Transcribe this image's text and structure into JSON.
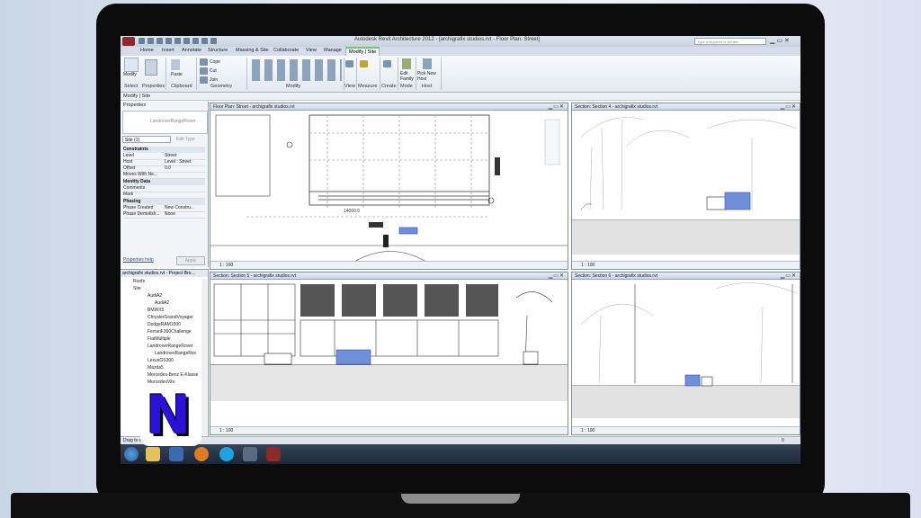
{
  "window": {
    "title": "Autodesk Revit Architecture 2012 - [archigrafix studios.rvt - Floor Plan: Street]",
    "search_placeholder": "Type a keyword or phrase"
  },
  "ribbon_tabs": [
    "Home",
    "Insert",
    "Annotate",
    "Structure",
    "Massing & Site",
    "Collaborate",
    "View",
    "Manage",
    "Modify | Site"
  ],
  "ribbon": {
    "buttons": {
      "modify": "Modify",
      "paste": "Paste",
      "cope": "Cope",
      "cut": "Cut",
      "join": "Join",
      "edit_family": "Edit Family",
      "pick_new_host": "Pick New Host"
    },
    "panels": [
      "Select",
      "Properties",
      "Clipboard",
      "Geometry",
      "Modify",
      "View",
      "Measure",
      "Create",
      "Mode",
      "Host"
    ]
  },
  "context_bar": "Modify | Site",
  "properties": {
    "title": "Properties",
    "type_name": "LandroverRangeRover",
    "selector": "Site (1)",
    "edit_type": "Edit Type",
    "groups": [
      {
        "name": "Constraints",
        "rows": [
          {
            "k": "Level",
            "v": "Street"
          },
          {
            "k": "Host",
            "v": "Level : Street"
          },
          {
            "k": "Offset",
            "v": "0.0"
          },
          {
            "k": "Moves With Ne...",
            "v": ""
          }
        ]
      },
      {
        "name": "Identity Data",
        "rows": [
          {
            "k": "Comments",
            "v": ""
          },
          {
            "k": "Mark",
            "v": ""
          }
        ]
      },
      {
        "name": "Phasing",
        "rows": [
          {
            "k": "Phase Created",
            "v": "New Constru..."
          },
          {
            "k": "Phase Demolish...",
            "v": "None"
          }
        ]
      }
    ],
    "help_link": "Properties help",
    "apply": "Apply"
  },
  "project_browser": {
    "title": "archigrafix studios.rvt - Project Bro...",
    "items": [
      "Roofs",
      "Site",
      "AudiA2",
      "AudiA2",
      "BMWX5",
      "ChryslerGrandVoyager",
      "DodgeRAM1500",
      "FerrariF360Challenge",
      "FiatMultiple",
      "LandroverRangeRover",
      "LandroverRangeRov",
      "LexusGS300",
      "Mazda5",
      "Mercedes-Benz E-Klasse",
      "MercedesVito"
    ]
  },
  "views": {
    "floor_plan": {
      "title": "Floor Plan: Street - archigrafix studios.rvt",
      "scale": "1 : 100",
      "dim": "14000.0"
    },
    "section4": {
      "title": "Section: Section 4 - archigrafix studios.rvt",
      "scale": "1 : 100"
    },
    "section5": {
      "title": "Section: Section 5 - archigrafix studios.rvt",
      "scale": "1 : 100"
    },
    "section6": {
      "title": "Section: Section 6 - archigrafix studios.rvt",
      "scale": "1 : 100"
    }
  },
  "status": {
    "text": "Drag to move",
    "right": "0"
  },
  "colors": {
    "accent": "#2b12d6",
    "car_blue": "#6f8fd8"
  }
}
